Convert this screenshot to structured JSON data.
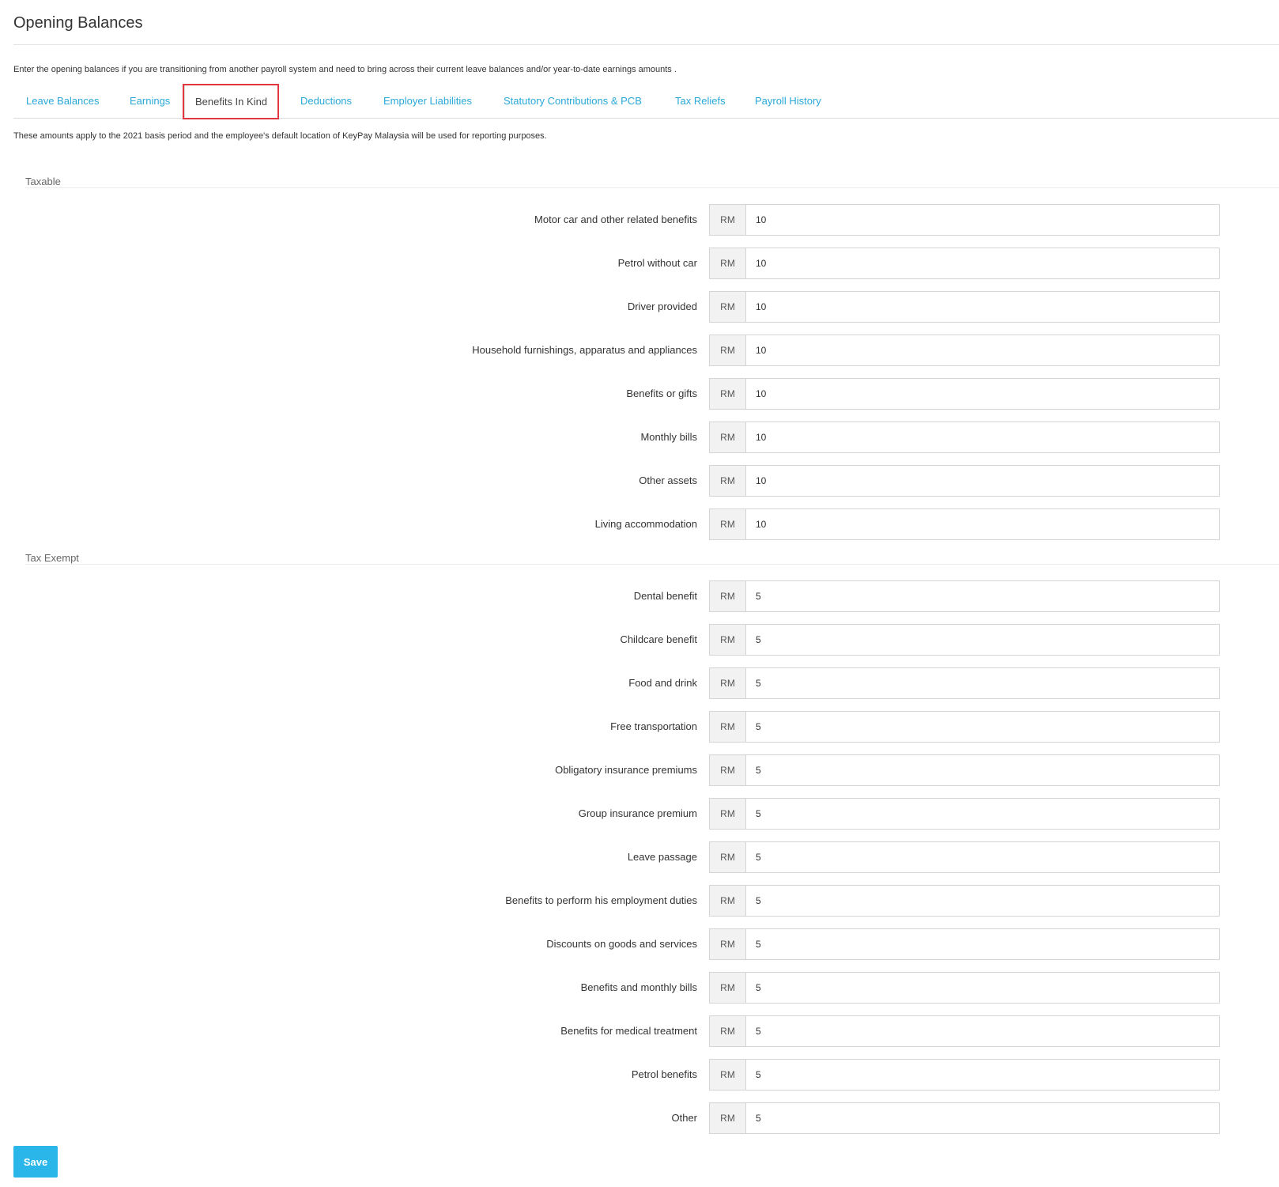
{
  "page": {
    "title": "Opening Balances",
    "intro": "Enter the opening balances if you are transitioning from another payroll system and need to bring across their current leave balances and/or year-to-date earnings amounts .",
    "basis_note": "These amounts apply to the 2021 basis period and the employee's default location of KeyPay Malaysia will be used for reporting purposes."
  },
  "tabs": [
    {
      "label": "Leave Balances",
      "active": false
    },
    {
      "label": "Earnings",
      "active": false
    },
    {
      "label": "Benefits In Kind",
      "active": true
    },
    {
      "label": "Deductions",
      "active": false
    },
    {
      "label": "Employer Liabilities",
      "active": false
    },
    {
      "label": "Statutory Contributions & PCB",
      "active": false
    },
    {
      "label": "Tax Reliefs",
      "active": false
    },
    {
      "label": "Payroll History",
      "active": false
    }
  ],
  "currency": "RM",
  "sections": {
    "taxable": {
      "label": "Taxable",
      "fields": [
        {
          "label": "Motor car and other related benefits",
          "value": "10"
        },
        {
          "label": "Petrol without car",
          "value": "10"
        },
        {
          "label": "Driver provided",
          "value": "10"
        },
        {
          "label": "Household furnishings, apparatus and appliances",
          "value": "10"
        },
        {
          "label": "Benefits or gifts",
          "value": "10"
        },
        {
          "label": "Monthly bills",
          "value": "10"
        },
        {
          "label": "Other assets",
          "value": "10"
        },
        {
          "label": "Living accommodation",
          "value": "10"
        }
      ]
    },
    "tax_exempt": {
      "label": "Tax Exempt",
      "fields": [
        {
          "label": "Dental benefit",
          "value": "5"
        },
        {
          "label": "Childcare benefit",
          "value": "5"
        },
        {
          "label": "Food and drink",
          "value": "5"
        },
        {
          "label": "Free transportation",
          "value": "5"
        },
        {
          "label": "Obligatory insurance premiums",
          "value": "5"
        },
        {
          "label": "Group insurance premium",
          "value": "5"
        },
        {
          "label": "Leave passage",
          "value": "5"
        },
        {
          "label": "Benefits to perform his employment duties",
          "value": "5"
        },
        {
          "label": "Discounts on goods and services",
          "value": "5"
        },
        {
          "label": "Benefits and monthly bills",
          "value": "5"
        },
        {
          "label": "Benefits for medical treatment",
          "value": "5"
        },
        {
          "label": "Petrol benefits",
          "value": "5"
        },
        {
          "label": "Other",
          "value": "5"
        }
      ]
    }
  },
  "actions": {
    "save_label": "Save"
  },
  "colors": {
    "link": "#2aa8d8",
    "primary_button": "#2bb6ea",
    "highlight": "#e0383e"
  }
}
